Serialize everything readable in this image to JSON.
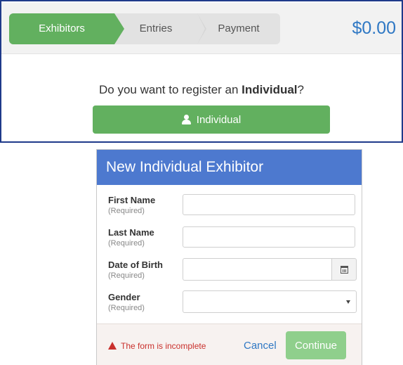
{
  "wizard": {
    "steps": [
      {
        "label": "Exhibitors",
        "state": "active"
      },
      {
        "label": "Entries",
        "state": "inactive"
      },
      {
        "label": "Payment",
        "state": "inactive"
      }
    ],
    "total": "$0.00"
  },
  "register": {
    "question_prefix": "Do you want to register an ",
    "question_bold": "Individual",
    "question_suffix": "?",
    "button_label": "Individual",
    "button_icon": "user-icon"
  },
  "modal": {
    "title": "New Individual Exhibitor",
    "fields": [
      {
        "label": "First Name",
        "hint": "(Required)",
        "value": "",
        "type": "text"
      },
      {
        "label": "Last Name",
        "hint": "(Required)",
        "value": "",
        "type": "text"
      },
      {
        "label": "Date of Birth",
        "hint": "(Required)",
        "value": "",
        "type": "date"
      },
      {
        "label": "Gender",
        "hint": "(Required)",
        "value": "",
        "type": "select"
      }
    ],
    "footer": {
      "warning": "The form is incomplete",
      "cancel_label": "Cancel",
      "continue_label": "Continue"
    }
  },
  "colors": {
    "success": "#62b05f",
    "primary": "#4d79cf",
    "link": "#2f78c4",
    "danger": "#c9302c"
  }
}
